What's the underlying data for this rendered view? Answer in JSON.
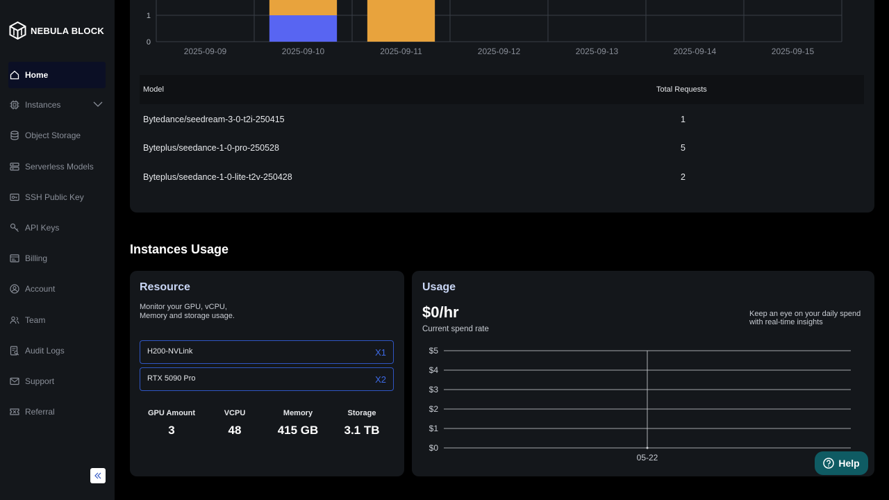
{
  "brand": {
    "name": "NEBULA BLOCK"
  },
  "sidebar": {
    "items": [
      {
        "label": "Home",
        "icon": "home-icon"
      },
      {
        "label": "Instances",
        "icon": "cpu-icon"
      },
      {
        "label": "Object Storage",
        "icon": "database-icon"
      },
      {
        "label": "Serverless Models",
        "icon": "server-icon"
      },
      {
        "label": "SSH Public Key",
        "icon": "key-card-icon"
      },
      {
        "label": "API Keys",
        "icon": "key-icon"
      },
      {
        "label": "Billing",
        "icon": "billing-icon"
      },
      {
        "label": "Account",
        "icon": "user-icon"
      },
      {
        "label": "Team",
        "icon": "team-icon"
      },
      {
        "label": "Audit Logs",
        "icon": "audit-icon"
      },
      {
        "label": "Support",
        "icon": "mail-icon"
      },
      {
        "label": "Referral",
        "icon": "ticket-icon"
      }
    ]
  },
  "requests_table": {
    "headers": {
      "model": "Model",
      "total": "Total Requests"
    },
    "rows": [
      {
        "model": "Bytedance/seedream-3-0-t2i-250415",
        "total": "1"
      },
      {
        "model": "Byteplus/seedance-1-0-pro-250528",
        "total": "5"
      },
      {
        "model": "Byteplus/seedance-1-0-lite-t2v-250428",
        "total": "2"
      }
    ]
  },
  "instances": {
    "section_title": "Instances Usage",
    "resource": {
      "title": "Resource",
      "description_line1": "Monitor your GPU, vCPU,",
      "description_line2": "Memory and storage usage.",
      "gpus": [
        {
          "name": "H200-NVLink",
          "qty": "X1"
        },
        {
          "name": "RTX 5090 Pro",
          "qty": "X2"
        }
      ],
      "stats": [
        {
          "label": "GPU Amount",
          "value": "3"
        },
        {
          "label": "VCPU",
          "value": "48"
        },
        {
          "label": "Memory",
          "value": "415 GB"
        },
        {
          "label": "Storage",
          "value": "3.1 TB"
        }
      ]
    },
    "usage": {
      "title": "Usage",
      "rate": "$0/hr",
      "rate_caption": "Current spend rate",
      "hint_line1": "Keep an eye on your daily spend",
      "hint_line2": "with real-time insights"
    }
  },
  "help": {
    "label": "Help"
  },
  "colors": {
    "accent_blue": "#5865f2",
    "accent_orange": "#e8a33d",
    "help_bg": "#0f5b63",
    "gpu_border": "#2f56c4"
  },
  "chart_data": [
    {
      "type": "bar",
      "stacked": true,
      "categories": [
        "2025-09-09",
        "2025-09-10",
        "2025-09-11",
        "2025-09-12",
        "2025-09-13",
        "2025-09-14",
        "2025-09-15"
      ],
      "series": [
        {
          "color": "#5865f2",
          "values": [
            0,
            1,
            0,
            0,
            0,
            0,
            0
          ]
        },
        {
          "color": "#e8a33d",
          "values": [
            0,
            2,
            5,
            0,
            0,
            0,
            0
          ]
        }
      ],
      "y_ticks": [
        "0",
        "1"
      ],
      "ylim": [
        0,
        1.5
      ],
      "grid": true
    },
    {
      "type": "line",
      "categories": [
        "05-22"
      ],
      "y_ticks": [
        "$0",
        "$1",
        "$2",
        "$3",
        "$4",
        "$5"
      ],
      "ylim": [
        0,
        5
      ],
      "series": [
        {
          "values": [
            0
          ]
        }
      ],
      "grid": true
    }
  ]
}
